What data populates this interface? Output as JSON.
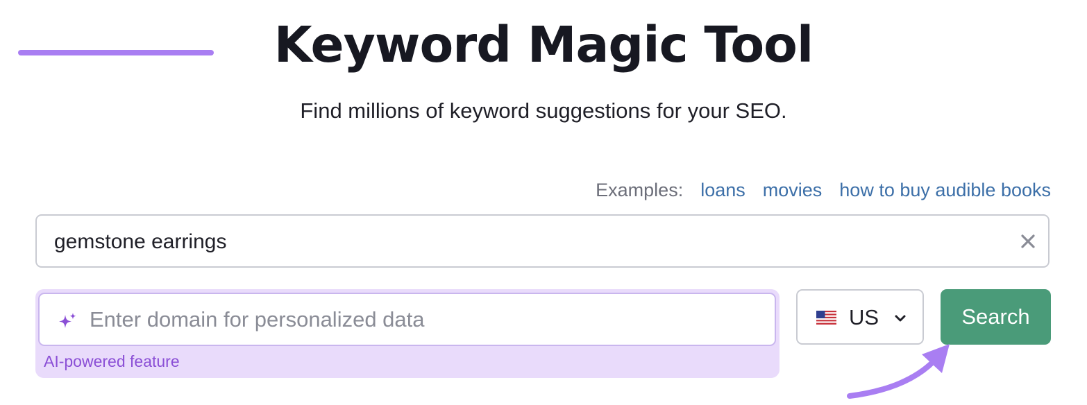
{
  "header": {
    "title": "Keyword Magic Tool",
    "subtitle": "Find millions of keyword suggestions for your SEO."
  },
  "examples": {
    "label": "Examples:",
    "links": [
      "loans",
      "movies",
      "how to buy audible books"
    ]
  },
  "keyword_input": {
    "value": "gemstone earrings",
    "clear_icon": "close-icon"
  },
  "domain_input": {
    "placeholder": "Enter domain for personalized data",
    "icon": "sparkle-icon",
    "caption": "AI-powered feature"
  },
  "country_select": {
    "selected": "US",
    "flag_icon": "us-flag-icon",
    "chevron_icon": "chevron-down-icon"
  },
  "search_button": {
    "label": "Search"
  },
  "colors": {
    "accent_purple": "#a97ef2",
    "ai_panel_bg": "#e9dbfb",
    "ai_caption": "#8b4fd6",
    "link_blue": "#3c6fa8",
    "search_green": "#4a9b79",
    "border_gray": "#c9cbd2"
  }
}
